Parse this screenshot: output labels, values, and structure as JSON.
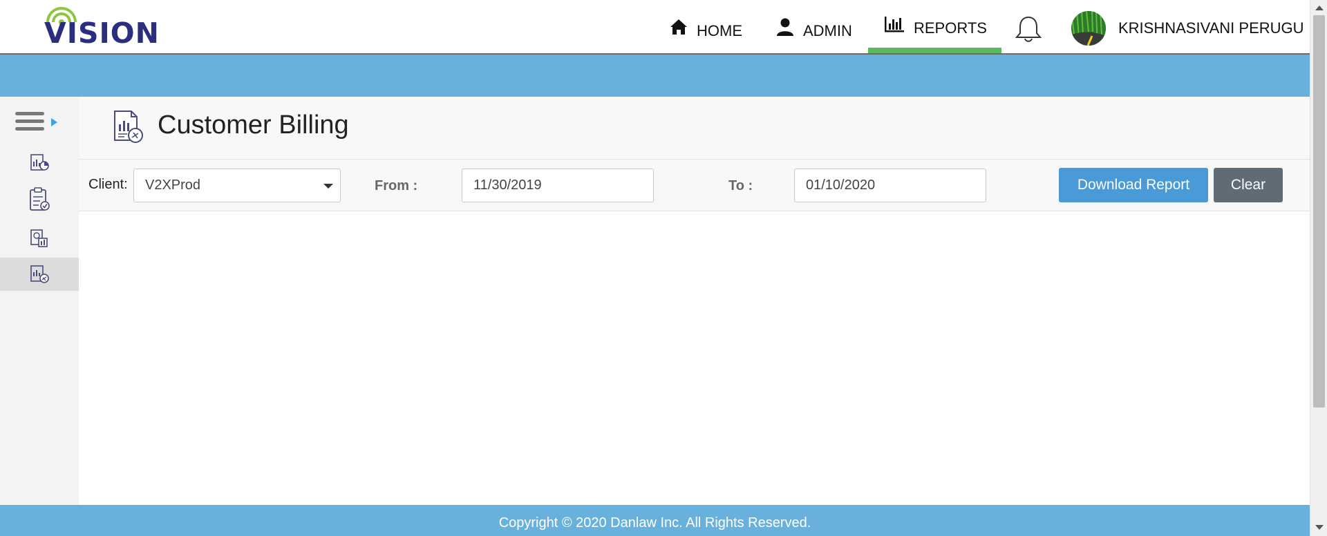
{
  "brand": {
    "logo_text": "VISION",
    "accent_green": "#8dc63f",
    "logo_blue": "#2b2e7e"
  },
  "nav": {
    "items": [
      {
        "label": "HOME",
        "icon": "home-icon"
      },
      {
        "label": "ADMIN",
        "icon": "user-icon"
      },
      {
        "label": "REPORTS",
        "icon": "bar-chart-icon",
        "active": true
      }
    ],
    "notifications_icon": "bell-icon",
    "user_name": "KRISHNASIVANI PERUGU"
  },
  "sidebar": {
    "toggle_icon": "hamburger-menu-icon",
    "items": [
      {
        "icon": "report-chart-icon"
      },
      {
        "icon": "clipboard-car-icon"
      },
      {
        "icon": "report-building-icon"
      },
      {
        "icon": "billing-report-icon",
        "active": true
      }
    ]
  },
  "page": {
    "title": "Customer Billing",
    "title_icon": "billing-report-icon"
  },
  "filters": {
    "client_label": "Client:",
    "client_value": "V2XProd",
    "from_label": "From :",
    "from_value": "11/30/2019",
    "to_label": "To :",
    "to_value": "01/10/2020",
    "download_label": "Download Report",
    "clear_label": "Clear"
  },
  "footer": {
    "text": "Copyright © 2020 Danlaw Inc. All Rights Reserved."
  },
  "colors": {
    "band_blue": "#69b1dd",
    "active_tab_green": "#5cb85c",
    "primary_button": "#4a9ad8",
    "secondary_button": "#5f6b75"
  }
}
